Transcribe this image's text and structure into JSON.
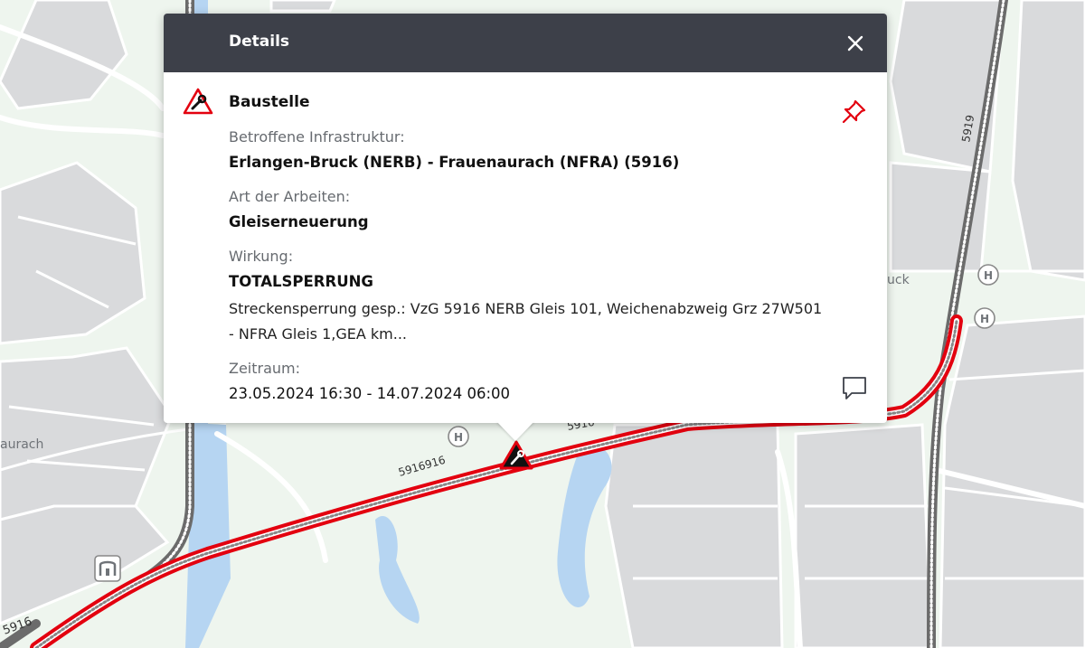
{
  "popup": {
    "title": "Details",
    "close_icon": "close-icon",
    "type": "Baustelle",
    "type_icon": "construction-warning-icon",
    "pin_icon": "pin-icon",
    "comment_icon": "comment-icon",
    "accent_color": "#e3000f",
    "fields": {
      "infrastructure_label": "Betroffene Infrastruktur:",
      "infrastructure_value": "Erlangen-Bruck (NERB) - Frauenaurach (NFRA) (5916)",
      "work_label": "Art der Arbeiten:",
      "work_value": "Gleiserneuerung",
      "effect_label": "Wirkung:",
      "effect_value": "TOTALSPERRUNG",
      "effect_description": "Streckensperrung gesp.: VzG 5916 NERB Gleis 101, Weichenabzweig Grz 27W501 - NFRA Gleis 1,GEA km...",
      "period_label": "Zeitraum:",
      "period_start": "23.05.2024 16:30",
      "period_sep": " - ",
      "period_end": "14.07.2024 06:00"
    }
  },
  "map": {
    "line_labels": [
      "5916",
      "5916916",
      "5916",
      "5919"
    ],
    "place_labels": [
      "aurach",
      "uck"
    ],
    "bus_stop_label": "H",
    "affected_line_color": "#e3000f",
    "rail_color": "#6b6b6b",
    "water_color": "#b6d5f2",
    "urban_color": "#d9dadc"
  }
}
